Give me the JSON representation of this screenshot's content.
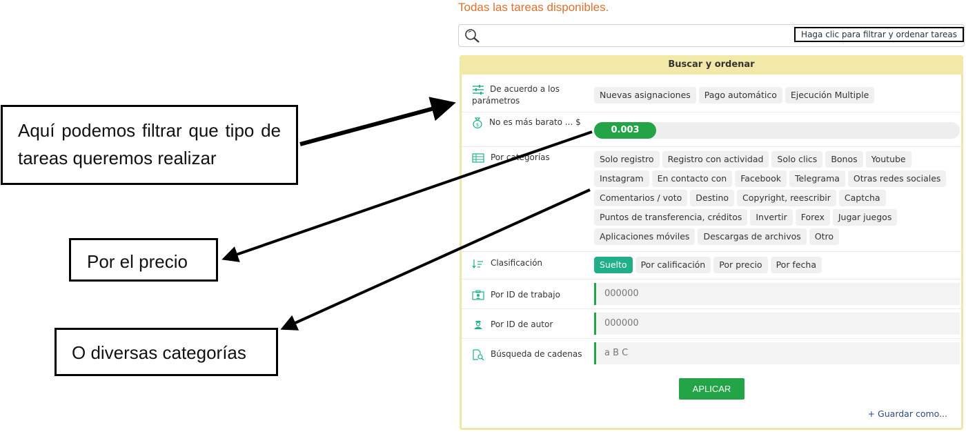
{
  "page": {
    "title": "Todas las tareas disponibles."
  },
  "search": {
    "hint": "Haga clic para filtrar y ordenar tareas"
  },
  "panel": {
    "header": "Buscar y ordenar",
    "params": {
      "label": "De acuerdo a los parámetros",
      "chips": [
        "Nuevas asignaciones",
        "Pago automático",
        "Ejecución Multiple"
      ]
    },
    "price": {
      "label": "No es más barato ... $",
      "value": "0.003",
      "fill_fraction": 0.17
    },
    "categories": {
      "label": "Por categorías",
      "chips": [
        [
          "Solo registro",
          "Registro con actividad",
          "Solo clics",
          "Bonos",
          "Youtube"
        ],
        [
          "Instagram",
          "En contacto con",
          "Facebook",
          "Telegrama",
          "Otras redes sociales"
        ],
        [
          "Comentarios / voto",
          "Destino",
          "Copyright, reescribir",
          "Captcha"
        ],
        [
          "Puntos de transferencia, créditos",
          "Invertir",
          "Forex",
          "Jugar juegos"
        ],
        [
          "Aplicaciones móviles",
          "Descargas de archivos",
          "Otro"
        ]
      ]
    },
    "sort": {
      "label": "Clasificación",
      "options": [
        "Suelto",
        "Por calificación",
        "Por precio",
        "Por fecha"
      ],
      "selected": "Suelto"
    },
    "job_id": {
      "label": "Por ID de trabajo",
      "placeholder": "000000"
    },
    "author_id": {
      "label": "Por ID de autor",
      "placeholder": "000000"
    },
    "string_search": {
      "label": "Búsqueda de cadenas",
      "placeholder": "a B C"
    },
    "apply_label": "APLICAR",
    "save_as_label": "+ Guardar como..."
  },
  "callouts": {
    "filter": "Aquí podemos filtrar que tipo de tareas queremos realizar",
    "price": "Por el precio",
    "categories": "O diversas categorías"
  },
  "colors": {
    "accent_green": "#22a447",
    "teal": "#1fb08a",
    "title_orange": "#e0702d",
    "panel_header": "#f2e9a8"
  }
}
